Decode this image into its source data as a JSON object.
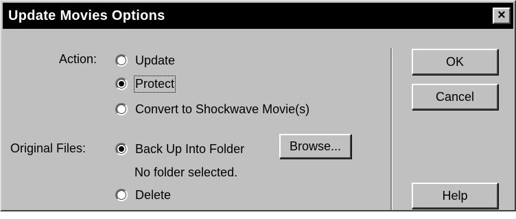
{
  "window": {
    "title": "Update Movies Options",
    "close_glyph": "×"
  },
  "action": {
    "label": "Action:",
    "options": [
      {
        "label": "Update",
        "selected": false
      },
      {
        "label": "Protect",
        "selected": true
      },
      {
        "label": "Convert to Shockwave Movie(s)",
        "selected": false
      }
    ]
  },
  "original_files": {
    "label": "Original Files:",
    "options": [
      {
        "label": "Back Up Into Folder",
        "selected": true
      },
      {
        "label": "Delete",
        "selected": false
      }
    ],
    "folder_status": "No folder selected.",
    "browse_label": "Browse..."
  },
  "buttons": {
    "ok": "OK",
    "cancel": "Cancel",
    "help": "Help"
  }
}
